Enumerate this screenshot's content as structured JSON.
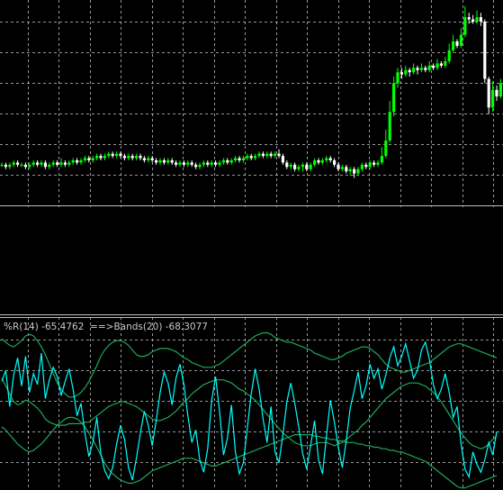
{
  "indicator_label": "%R(14) -65.4762  ==>Bands(20) -68.3077",
  "colors": {
    "background": "#000000",
    "grid": "#c8c8c8",
    "candle_up": "#00ff00",
    "candle_down": "#ffffff",
    "wpr_line": "#00ffff",
    "bands_line": "#1fa85a",
    "separator": "#c0c0c0"
  },
  "chart_data": [
    {
      "type": "candlestick",
      "title": "",
      "candles": [
        [
          66,
          66,
          65,
          67
        ],
        [
          66,
          65,
          64,
          67
        ],
        [
          65,
          66,
          64,
          67
        ],
        [
          66,
          67,
          65,
          68
        ],
        [
          67,
          66,
          65,
          68
        ],
        [
          66,
          66,
          65,
          67
        ],
        [
          66,
          65,
          64,
          67
        ],
        [
          65,
          66,
          64,
          67
        ],
        [
          66,
          67,
          65,
          68
        ],
        [
          67,
          66,
          65,
          68
        ],
        [
          66,
          67,
          65,
          68
        ],
        [
          67,
          65,
          64,
          68
        ],
        [
          65,
          66,
          64,
          67
        ],
        [
          66,
          67,
          65,
          68
        ],
        [
          67,
          66,
          65,
          68
        ],
        [
          66,
          67,
          65,
          69
        ],
        [
          67,
          66,
          65,
          68
        ],
        [
          66,
          67,
          65,
          68
        ],
        [
          67,
          68,
          66,
          69
        ],
        [
          68,
          67,
          66,
          69
        ],
        [
          67,
          68,
          66,
          69
        ],
        [
          68,
          69,
          67,
          70
        ],
        [
          69,
          68,
          67,
          70
        ],
        [
          68,
          69,
          67,
          70
        ],
        [
          69,
          70,
          68,
          71
        ],
        [
          70,
          69,
          68,
          71
        ],
        [
          69,
          70,
          68,
          71
        ],
        [
          70,
          71,
          69,
          72
        ],
        [
          71,
          70,
          69,
          72
        ],
        [
          70,
          71,
          69,
          72
        ],
        [
          71,
          70,
          69,
          72
        ],
        [
          70,
          69,
          68,
          71
        ],
        [
          69,
          70,
          68,
          71
        ],
        [
          70,
          69,
          68,
          71
        ],
        [
          69,
          70,
          68,
          71
        ],
        [
          70,
          69,
          68,
          71
        ],
        [
          69,
          68,
          67,
          70
        ],
        [
          68,
          69,
          67,
          70
        ],
        [
          69,
          68,
          67,
          70
        ],
        [
          68,
          67,
          66,
          69
        ],
        [
          67,
          68,
          66,
          69
        ],
        [
          68,
          67,
          66,
          69
        ],
        [
          67,
          68,
          66,
          69
        ],
        [
          68,
          67,
          66,
          69
        ],
        [
          67,
          66,
          65,
          68
        ],
        [
          66,
          67,
          65,
          68
        ],
        [
          67,
          66,
          65,
          68
        ],
        [
          66,
          67,
          65,
          68
        ],
        [
          67,
          66,
          65,
          68
        ],
        [
          66,
          65,
          64,
          67
        ],
        [
          65,
          66,
          64,
          67
        ],
        [
          66,
          67,
          65,
          68
        ],
        [
          67,
          66,
          65,
          68
        ],
        [
          66,
          67,
          65,
          68
        ],
        [
          67,
          66,
          65,
          68
        ],
        [
          66,
          67,
          65,
          68
        ],
        [
          67,
          68,
          66,
          69
        ],
        [
          68,
          67,
          66,
          69
        ],
        [
          67,
          68,
          66,
          69
        ],
        [
          68,
          69,
          67,
          70
        ],
        [
          69,
          68,
          67,
          70
        ],
        [
          68,
          69,
          67,
          70
        ],
        [
          69,
          70,
          68,
          71
        ],
        [
          70,
          69,
          68,
          71
        ],
        [
          69,
          70,
          68,
          71
        ],
        [
          70,
          71,
          69,
          72
        ],
        [
          71,
          70,
          69,
          72
        ],
        [
          70,
          71,
          69,
          72
        ],
        [
          71,
          70,
          69,
          72
        ],
        [
          70,
          71,
          69,
          72
        ],
        [
          71,
          70,
          69,
          73
        ],
        [
          70,
          67,
          66,
          71
        ],
        [
          67,
          65,
          64,
          68
        ],
        [
          65,
          66,
          64,
          67
        ],
        [
          66,
          64,
          63,
          67
        ],
        [
          64,
          65,
          63,
          66
        ],
        [
          65,
          66,
          63,
          67
        ],
        [
          66,
          64,
          63,
          67
        ],
        [
          64,
          66,
          63,
          67
        ],
        [
          66,
          68,
          65,
          69
        ],
        [
          68,
          67,
          66,
          69
        ],
        [
          67,
          68,
          66,
          69
        ],
        [
          68,
          69,
          67,
          70
        ],
        [
          69,
          68,
          67,
          70
        ],
        [
          68,
          66,
          65,
          69
        ],
        [
          66,
          64,
          63,
          67
        ],
        [
          64,
          65,
          63,
          66
        ],
        [
          65,
          63,
          62,
          66
        ],
        [
          63,
          64,
          61,
          65
        ],
        [
          64,
          62,
          60,
          65
        ],
        [
          62,
          64,
          61,
          65
        ],
        [
          64,
          66,
          63,
          67
        ],
        [
          66,
          65,
          64,
          67
        ],
        [
          65,
          67,
          64,
          68
        ],
        [
          67,
          66,
          65,
          68
        ],
        [
          66,
          67,
          65,
          68
        ],
        [
          67,
          70,
          66,
          74
        ],
        [
          70,
          77,
          69,
          82
        ],
        [
          77,
          90,
          76,
          95
        ],
        [
          90,
          103,
          88,
          106
        ],
        [
          103,
          108,
          101,
          110
        ],
        [
          108,
          107,
          105,
          110
        ],
        [
          107,
          109,
          106,
          111
        ],
        [
          109,
          108,
          106,
          110
        ],
        [
          108,
          110,
          107,
          112
        ],
        [
          110,
          109,
          107,
          111
        ],
        [
          109,
          110,
          108,
          112
        ],
        [
          110,
          109,
          108,
          111
        ],
        [
          109,
          111,
          108,
          113
        ],
        [
          111,
          110,
          109,
          112
        ],
        [
          110,
          112,
          109,
          114
        ],
        [
          112,
          111,
          110,
          113
        ],
        [
          111,
          113,
          110,
          115
        ],
        [
          113,
          118,
          112,
          121
        ],
        [
          118,
          122,
          117,
          125
        ],
        [
          122,
          120,
          119,
          123
        ],
        [
          120,
          125,
          119,
          128
        ],
        [
          125,
          133,
          124,
          138
        ],
        [
          133,
          132,
          130,
          135
        ],
        [
          132,
          131,
          130,
          134
        ],
        [
          131,
          133,
          130,
          136
        ],
        [
          133,
          131,
          129,
          135
        ],
        [
          131,
          105,
          103,
          132
        ],
        [
          105,
          92,
          89,
          106
        ],
        [
          92,
          100,
          90,
          104
        ],
        [
          100,
          97,
          95,
          102
        ],
        [
          97,
          103,
          96,
          105
        ],
        [
          103,
          100,
          98,
          104
        ],
        [
          100,
          104,
          99,
          106
        ],
        [
          104,
          101,
          99,
          105
        ],
        [
          101,
          103,
          100,
          105
        ],
        [
          103,
          99,
          97,
          104
        ],
        [
          99,
          100,
          97,
          102
        ],
        [
          100,
          97,
          96,
          101
        ],
        [
          97,
          98,
          96,
          100
        ]
      ]
    },
    {
      "type": "line",
      "title": "%R(14) -65.4762  ==>Bands(20) -68.3077",
      "series": [
        {
          "name": "%R(14)",
          "values": [
            -33,
            -26,
            -49,
            -29,
            -18,
            -36,
            -17,
            -40,
            -28,
            -35,
            -15,
            -44,
            -32,
            -24,
            -30,
            -42,
            -33,
            -25,
            -38,
            -55,
            -47,
            -66,
            -81,
            -72,
            -56,
            -79,
            -90,
            -95,
            -88,
            -73,
            -61,
            -70,
            -88,
            -96,
            -82,
            -66,
            -52,
            -61,
            -74,
            -58,
            -40,
            -27,
            -34,
            -48,
            -31,
            -22,
            -35,
            -55,
            -72,
            -64,
            -83,
            -91,
            -76,
            -45,
            -30,
            -52,
            -80,
            -69,
            -48,
            -78,
            -92,
            -85,
            -63,
            -41,
            -25,
            -38,
            -57,
            -72,
            -49,
            -78,
            -85,
            -67,
            -46,
            -34,
            -47,
            -62,
            -79,
            -89,
            -74,
            -58,
            -83,
            -92,
            -68,
            -45,
            -59,
            -75,
            -88,
            -71,
            -50,
            -39,
            -27,
            -44,
            -36,
            -22,
            -31,
            -25,
            -38,
            -29,
            -18,
            -11,
            -23,
            -17,
            -9,
            -20,
            -31,
            -26,
            -13,
            -8,
            -19,
            -35,
            -44,
            -38,
            -28,
            -40,
            -56,
            -49,
            -73,
            -89,
            -94,
            -78,
            -86,
            -91,
            -83,
            -72,
            -80,
            -65
          ]
        },
        {
          "name": "Bands(20)",
          "values": [
            -31,
            -36,
            -41,
            -46,
            -48,
            -47,
            -45,
            -46,
            -48,
            -50,
            -53,
            -57,
            -59,
            -60,
            -61,
            -61,
            -61,
            -60,
            -60,
            -60,
            -60,
            -59,
            -59,
            -57,
            -55,
            -53,
            -51,
            -49,
            -48,
            -47,
            -46,
            -46,
            -47,
            -48,
            -49,
            -51,
            -53,
            -55,
            -57,
            -58,
            -58,
            -57,
            -56,
            -54,
            -52,
            -49,
            -46,
            -44,
            -41,
            -39,
            -37,
            -35,
            -34,
            -33,
            -32,
            -32,
            -32,
            -33,
            -34,
            -36,
            -38,
            -39,
            -41,
            -43,
            -45,
            -48,
            -51,
            -54,
            -57,
            -60,
            -63,
            -66,
            -68,
            -70,
            -72,
            -73,
            -74,
            -74,
            -74,
            -73,
            -72,
            -72,
            -72,
            -73,
            -74,
            -73,
            -72,
            -70,
            -68,
            -66,
            -64,
            -61,
            -59,
            -56,
            -53,
            -50,
            -47,
            -44,
            -42,
            -40,
            -38,
            -36,
            -35,
            -34,
            -34,
            -34,
            -35,
            -36,
            -38,
            -40,
            -43,
            -46,
            -50,
            -54,
            -58,
            -62,
            -66,
            -69,
            -72,
            -74,
            -75,
            -76,
            -75,
            -73,
            -70,
            -68
          ]
        },
        {
          "name": "upper band",
          "values": [
            -6,
            -8,
            -10,
            -11,
            -9,
            -7,
            -4,
            -3,
            -4,
            -7,
            -11,
            -16,
            -22,
            -28,
            -34,
            -38,
            -41,
            -43,
            -43,
            -42,
            -40,
            -37,
            -33,
            -28,
            -23,
            -17,
            -13,
            -10,
            -8,
            -7,
            -7,
            -8,
            -10,
            -13,
            -16,
            -17,
            -17,
            -16,
            -14,
            -13,
            -12,
            -12,
            -12,
            -13,
            -14,
            -16,
            -18,
            -19,
            -21,
            -22,
            -23,
            -24,
            -24,
            -24,
            -23,
            -22,
            -20,
            -18,
            -16,
            -14,
            -12,
            -10,
            -8,
            -6,
            -4,
            -3,
            -2,
            -2,
            -3,
            -5,
            -6,
            -7,
            -8,
            -8,
            -9,
            -10,
            -11,
            -12,
            -13,
            -15,
            -16,
            -17,
            -18,
            -19,
            -19,
            -18,
            -17,
            -15,
            -14,
            -13,
            -12,
            -11,
            -11,
            -12,
            -14,
            -16,
            -19,
            -22,
            -24,
            -25,
            -26,
            -27,
            -27,
            -26,
            -25,
            -24,
            -23,
            -22,
            -21,
            -19,
            -17,
            -15,
            -13,
            -11,
            -10,
            -9,
            -9,
            -10,
            -11,
            -12,
            -13,
            -14,
            -15,
            -16,
            -17,
            -18
          ]
        },
        {
          "name": "lower band",
          "values": [
            -62,
            -64,
            -67,
            -70,
            -73,
            -75,
            -77,
            -78,
            -77,
            -75,
            -73,
            -70,
            -67,
            -64,
            -61,
            -59,
            -57,
            -56,
            -56,
            -57,
            -59,
            -62,
            -66,
            -70,
            -75,
            -80,
            -85,
            -89,
            -92,
            -94,
            -96,
            -97,
            -98,
            -98,
            -97,
            -96,
            -94,
            -92,
            -90,
            -89,
            -88,
            -87,
            -86,
            -85,
            -84,
            -83,
            -82,
            -82,
            -82,
            -83,
            -84,
            -85,
            -86,
            -87,
            -87,
            -86,
            -85,
            -84,
            -83,
            -82,
            -81,
            -80,
            -79,
            -78,
            -77,
            -76,
            -75,
            -74,
            -73,
            -72,
            -71,
            -70,
            -69,
            -68,
            -67,
            -67,
            -67,
            -67,
            -67,
            -68,
            -68,
            -69,
            -69,
            -70,
            -70,
            -71,
            -71,
            -72,
            -72,
            -72,
            -73,
            -73,
            -74,
            -74,
            -75,
            -75,
            -76,
            -76,
            -77,
            -77,
            -78,
            -78,
            -79,
            -80,
            -81,
            -82,
            -83,
            -84,
            -86,
            -88,
            -90,
            -92,
            -94,
            -96,
            -98,
            -100,
            -101,
            -101,
            -100,
            -99,
            -98,
            -97,
            -96,
            -95,
            -94,
            -93
          ]
        }
      ],
      "ylim": [
        -100,
        0
      ]
    }
  ]
}
